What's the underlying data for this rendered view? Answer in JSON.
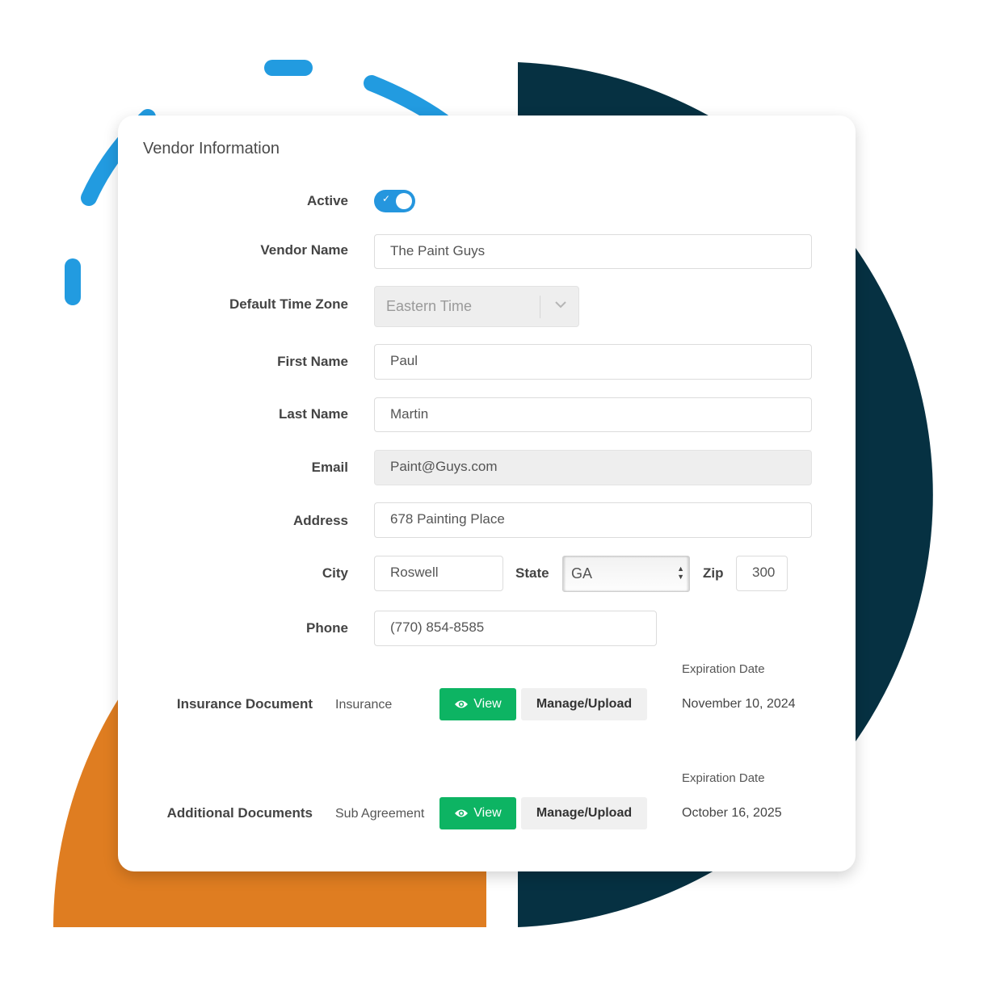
{
  "colors": {
    "orange": "#df7d21",
    "navy": "#063142",
    "dash_blue": "#229be0",
    "toggle_blue": "#2596de",
    "view_green": "#0db463"
  },
  "card": {
    "title": "Vendor Information",
    "active": {
      "label": "Active",
      "checked": true,
      "check_icon": "✓"
    },
    "vendor_name": {
      "label": "Vendor Name",
      "value": "The Paint Guys"
    },
    "time_zone": {
      "label": "Default Time Zone",
      "value": "Eastern Time"
    },
    "first_name": {
      "label": "First Name",
      "value": "Paul"
    },
    "last_name": {
      "label": "Last Name",
      "value": "Martin"
    },
    "email": {
      "label": "Email",
      "value": "Paint@Guys.com"
    },
    "address": {
      "label": "Address",
      "value": "678 Painting Place"
    },
    "city": {
      "label": "City",
      "value": "Roswell"
    },
    "state": {
      "label": "State",
      "value": "GA",
      "arrows": "▲▼"
    },
    "zip": {
      "label": "Zip",
      "value": "300"
    },
    "phone": {
      "label": "Phone",
      "value": "(770) 854-8585"
    },
    "documents": [
      {
        "label": "Insurance Document",
        "type": "Insurance",
        "view_label": "View",
        "manage_label": "Manage/Upload",
        "expiration_header": "Expiration Date",
        "expiration_date": "November 10, 2024"
      },
      {
        "label": "Additional Documents",
        "type": "Sub Agreement",
        "view_label": "View",
        "manage_label": "Manage/Upload",
        "expiration_header": "Expiration Date",
        "expiration_date": "October 16, 2025"
      }
    ]
  }
}
